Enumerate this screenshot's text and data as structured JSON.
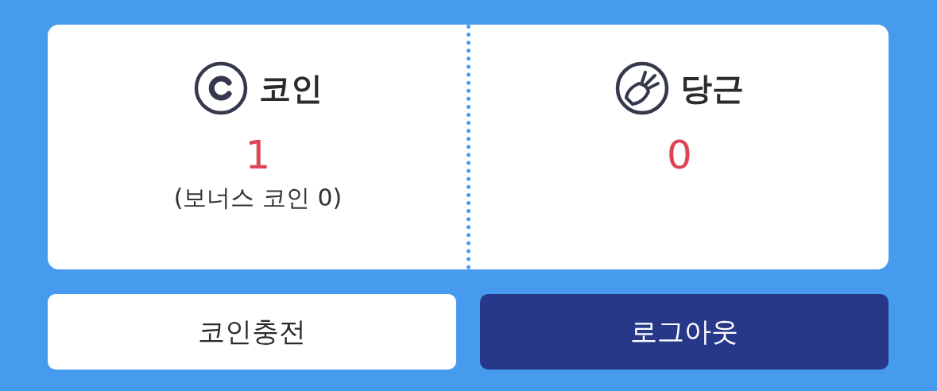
{
  "panels": [
    {
      "kind": "coin",
      "title": "코인",
      "value": "1",
      "note": "(보너스 코인 0)"
    },
    {
      "kind": "carrot",
      "title": "당근",
      "value": "0"
    }
  ],
  "buttons": [
    {
      "label": "코인충전",
      "kind": "secondary"
    },
    {
      "label": "로그아웃",
      "kind": "primary"
    }
  ]
}
